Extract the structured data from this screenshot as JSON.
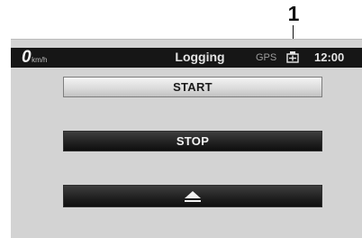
{
  "callout": {
    "number": "1"
  },
  "statusbar": {
    "speed_value": "0",
    "speed_unit": "km/h",
    "title": "Logging",
    "gps_label": "GPS",
    "gps_icon": "gps-signal-icon",
    "time": "12:00"
  },
  "buttons": {
    "start_label": "START",
    "stop_label": "STOP",
    "eject_icon": "eject-icon"
  },
  "colors": {
    "statusbar_bg": "#161616",
    "screen_bg": "#d3d3d3",
    "start_button": "#dcdcdc",
    "dark_button": "#222222"
  }
}
